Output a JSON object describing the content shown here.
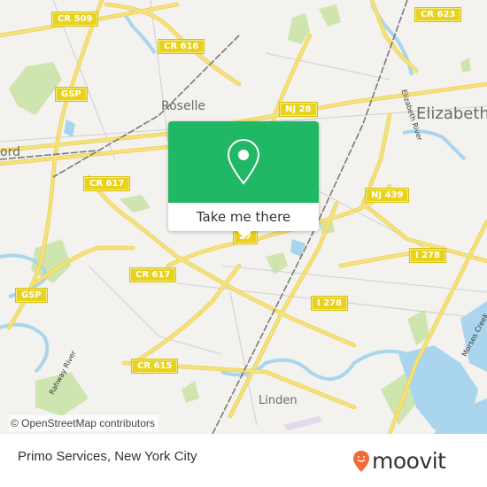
{
  "map": {
    "road_shields": [
      {
        "label": "CR 509",
        "id": "cr-509"
      },
      {
        "label": "CR 616",
        "id": "cr-616"
      },
      {
        "label": "CR 623",
        "id": "cr-623"
      },
      {
        "label": "GSP",
        "id": "gsp-north"
      },
      {
        "label": "NJ 28",
        "id": "nj-28"
      },
      {
        "label": "CR 617",
        "id": "cr-617-north"
      },
      {
        "label": "NJ 439",
        "id": "nj-439"
      },
      {
        "label": "27",
        "id": "us-27"
      },
      {
        "label": "I 278",
        "id": "i-278-east"
      },
      {
        "label": "GSP",
        "id": "gsp-south"
      },
      {
        "label": "CR 617",
        "id": "cr-617-south"
      },
      {
        "label": "I 278",
        "id": "i-278-south"
      },
      {
        "label": "CR 615",
        "id": "cr-615"
      }
    ],
    "places": [
      {
        "label": "Roselle",
        "id": "roselle"
      },
      {
        "label": "Elizabeth",
        "id": "elizabeth"
      },
      {
        "label": "ord",
        "id": "cranford-partial"
      },
      {
        "label": "Linden",
        "id": "linden"
      }
    ],
    "water_labels": [
      {
        "label": "Elizabeth River",
        "id": "elizabeth-river"
      },
      {
        "label": "Rahway River",
        "id": "rahway-river"
      },
      {
        "label": "Morses Creek",
        "id": "morses-creek"
      }
    ],
    "attribution": "© OpenStreetMap contributors",
    "colors": {
      "background": "#f3f2ee",
      "road": "#f7e27a",
      "water": "#a9d6ee",
      "park": "#cfe5b0",
      "rail": "#7a7a7a",
      "popup_green": "#20b765"
    }
  },
  "popup": {
    "icon": "location-pin-icon",
    "action_label": "Take me there"
  },
  "footer": {
    "title": "Primo Services, New York City",
    "brand": "moovit",
    "brand_icon": "moovit-smile-pin-icon",
    "brand_color": "#f26a36"
  }
}
